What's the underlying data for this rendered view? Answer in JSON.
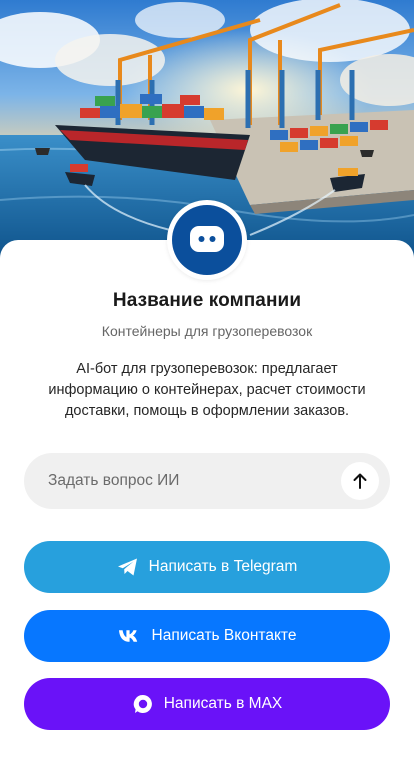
{
  "company": {
    "name": "Название компании",
    "subtitle": "Контейнеры для грузоперевозок",
    "description": "AI-бот для грузоперевозок: предлагает информацию о контейнерах, расчет стоимости доставки, помощь в оформлении заказов.",
    "logo_icon": "chat-bubble-icon"
  },
  "ai": {
    "placeholder": "Задать вопрос ИИ",
    "value": "",
    "send_icon": "arrow-up-icon"
  },
  "buttons": [
    {
      "label": "Написать в Telegram",
      "icon": "telegram-icon",
      "color": "#27a0dd"
    },
    {
      "label": "Написать Вконтакте",
      "icon": "vk-icon",
      "color": "#0777ff"
    },
    {
      "label": "Написать в MAX",
      "icon": "max-icon",
      "color": "#6a12f8"
    }
  ],
  "colors": {
    "logo_bg": "#0b4f9c",
    "input_bg": "#f0f0f0"
  }
}
